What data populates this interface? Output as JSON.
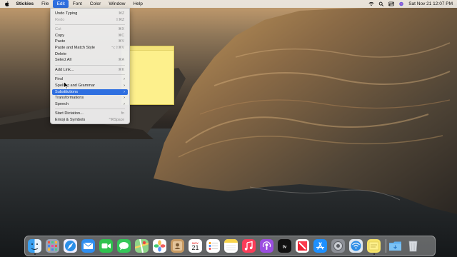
{
  "menubar": {
    "app_name": "Stickies",
    "menus": [
      "File",
      "Edit",
      "Font",
      "Color",
      "Window",
      "Help"
    ],
    "datetime": "Sat Nov 21  12:07 PM"
  },
  "edit_menu": {
    "items": [
      {
        "label": "Undo Typing",
        "shortcut": "⌘Z",
        "enabled": true
      },
      {
        "label": "Redo",
        "shortcut": "⇧⌘Z",
        "enabled": false
      },
      {
        "sep": true
      },
      {
        "label": "Cut",
        "shortcut": "⌘X",
        "enabled": false
      },
      {
        "label": "Copy",
        "shortcut": "⌘C",
        "enabled": true
      },
      {
        "label": "Paste",
        "shortcut": "⌘V",
        "enabled": true
      },
      {
        "label": "Paste and Match Style",
        "shortcut": "⌥⇧⌘V",
        "enabled": true
      },
      {
        "label": "Delete",
        "shortcut": "",
        "enabled": true
      },
      {
        "label": "Select All",
        "shortcut": "⌘A",
        "enabled": true
      },
      {
        "sep": true
      },
      {
        "label": "Add Link...",
        "shortcut": "⌘K",
        "enabled": true
      },
      {
        "sep": true
      },
      {
        "label": "Find",
        "submenu": true,
        "enabled": true
      },
      {
        "label": "Spelling and Grammar",
        "submenu": true,
        "enabled": true
      },
      {
        "label": "Substitutions",
        "submenu": true,
        "enabled": true,
        "highlighted": true
      },
      {
        "label": "Transformations",
        "submenu": true,
        "enabled": true
      },
      {
        "label": "Speech",
        "submenu": true,
        "enabled": true
      },
      {
        "sep": true
      },
      {
        "label": "Start Dictation...",
        "shortcut": "fn",
        "enabled": true
      },
      {
        "label": "Emoji & Symbols",
        "shortcut": "^⌘Space",
        "enabled": true
      }
    ]
  },
  "dock": {
    "calendar_month": "NOV",
    "calendar_day": "21",
    "apps": [
      "finder-icon",
      "launchpad-icon",
      "safari-icon",
      "mail-icon",
      "facetime-icon",
      "messages-icon",
      "maps-icon",
      "photos-icon",
      "contacts-icon",
      "calendar-icon",
      "reminders-icon",
      "notes-icon",
      "music-icon",
      "podcasts-icon",
      "apple-tv-icon",
      "news-icon",
      "app-store-icon",
      "system-preferences-icon",
      "network-utility-icon",
      "stickies-icon",
      "downloads-folder-icon",
      "trash-icon"
    ]
  }
}
